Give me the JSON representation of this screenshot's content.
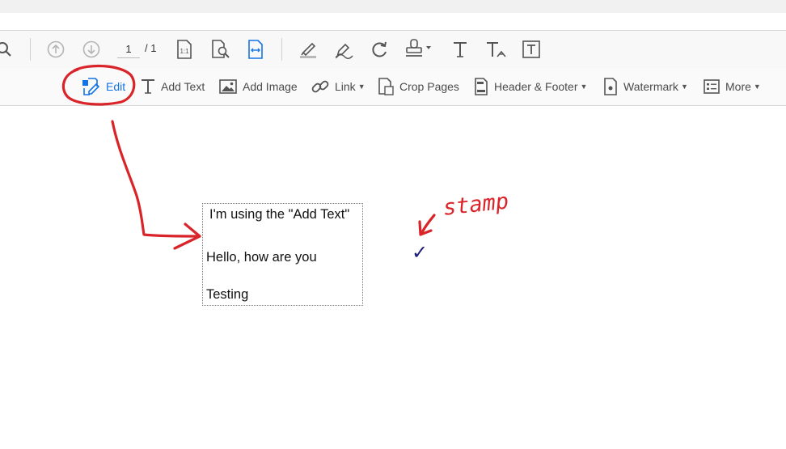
{
  "toolbar": {
    "page_current": "1",
    "page_total": "/ 1"
  },
  "edit_toolbar": {
    "edit": "Edit",
    "add_text": "Add Text",
    "add_image": "Add Image",
    "link": "Link",
    "crop_pages": "Crop Pages",
    "header_footer": "Header & Footer",
    "watermark": "Watermark",
    "more": "More"
  },
  "document": {
    "line1": "I'm using the \"Add Text\"",
    "line2": "Hello, how are you",
    "line3": "Testing",
    "stamp_glyph": "✓"
  },
  "annotation": {
    "stamp_label": "stamp",
    "ink_color": "#d9252a"
  },
  "colors": {
    "accent": "#1473e6",
    "icon": "#555555"
  }
}
